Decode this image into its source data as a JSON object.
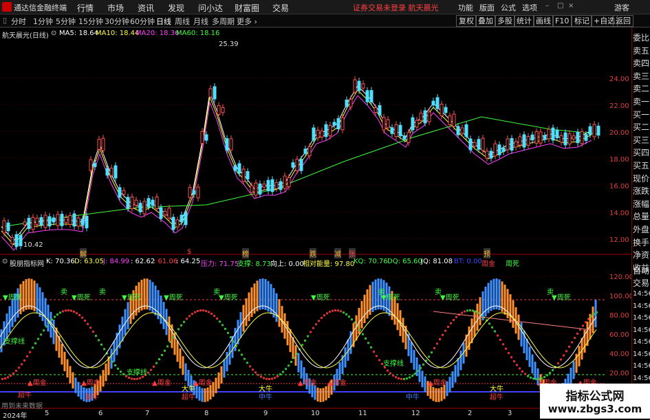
{
  "app": {
    "name": "通达信金融终端"
  },
  "menu": [
    "行情",
    "市场",
    "资讯",
    "发现",
    "问小达",
    "财富圈",
    "交易"
  ],
  "notice": "证券交易未登录  航天晨光",
  "right_menu": [
    "功能",
    "版面",
    "公式",
    "选项",
    "画线",
    "游客"
  ],
  "timeframes": [
    "分时",
    "1分钟",
    "5分钟",
    "15分钟",
    "30分钟",
    "60分钟",
    "日线",
    "周线",
    "月线",
    "多周期",
    "更多"
  ],
  "active_timeframe": "日线",
  "toolbar_buttons": [
    "复权",
    "叠加",
    "多股",
    "统计",
    "画线",
    "F10",
    "标记",
    "+自选",
    "返回"
  ],
  "price_chart": {
    "title": "航天晨光(日线)",
    "ma": [
      {
        "label": "MA5: 18.64",
        "color": "#ffffff"
      },
      {
        "label": "MA10: 18.44",
        "color": "#ffff40"
      },
      {
        "label": "MA20: 18.36",
        "color": "#ff40ff"
      },
      {
        "label": "MA60: 18.16",
        "color": "#40ff40"
      }
    ],
    "y_ticks": [
      "24.00",
      "22.00",
      "20.00",
      "18.00",
      "16.00",
      "14.00",
      "12.00"
    ],
    "high_label": "25.39",
    "low_label": "10.42",
    "event_markers": [
      "解",
      "$",
      "榜",
      "跌",
      "减",
      "张",
      "预"
    ]
  },
  "indicator": {
    "name": "股朋指标网",
    "values": [
      {
        "label": "K: 70.36",
        "color": "#ffffff"
      },
      {
        "label": "D: 63.05",
        "color": "#ffff40"
      },
      {
        "label": "J: 84.99",
        "color": "#ff40ff"
      },
      {
        "label": ": 62.62",
        "color": "#ffffff"
      },
      {
        "label": ": 61.06",
        "color": "#ff4040"
      },
      {
        "label": ": 64.25",
        "color": "#ffffff"
      },
      {
        "label": "压力: 71.75",
        "color": "#ff40ff"
      },
      {
        "label": "支撑: 8.73",
        "color": "#40ff40"
      },
      {
        "label": "向上: 0.00",
        "color": "#ffffff"
      },
      {
        "label": "相对能量: 97.80",
        "color": "#ffff40"
      },
      {
        "label": "KQ: 70.76",
        "color": "#40ff40"
      },
      {
        "label": "DQ: 65.60",
        "color": "#40ff40"
      },
      {
        "label": "JQ: 81.08",
        "color": "#ffffff"
      },
      {
        "label": "BT: 0.00",
        "color": "#4040ff"
      },
      {
        "label": "周金",
        "color": "#ff4040"
      },
      {
        "label": "周死",
        "color": "#40ff40"
      }
    ],
    "y_ticks": [
      "120.00",
      "100.00",
      "80.00",
      "60.00",
      "40.00",
      "20.00"
    ],
    "signals": {
      "zhousi": "周死",
      "mai": "卖",
      "zhoujin": "周金",
      "chaoniu": "超牛",
      "zhongniu": "中牛",
      "daniu": "大牛",
      "zhicheng": "支撑线"
    }
  },
  "x_axis": [
    "2024年",
    "5",
    "6",
    "7",
    "8",
    "9",
    "10",
    "11",
    "12",
    "2",
    "3",
    "4"
  ],
  "right_panel": [
    "委比",
    "卖五",
    "卖四",
    "卖三",
    "卖二",
    "卖一",
    "买一",
    "买二",
    "买三",
    "买四",
    "买五",
    "现价",
    "涨跌",
    "涨幅",
    "总量",
    "外盘",
    "换手",
    "净资",
    "收益"
  ],
  "right_panel_bottom": [
    "自动",
    "交易"
  ],
  "time_labels": [
    "14:56",
    "14:56",
    "14:56",
    "14:56",
    "14:56",
    "14:56",
    "14:56",
    "14:56"
  ],
  "footer_text": "用到未来数据",
  "watermark": {
    "line1": "指标公式网",
    "line2": "www.zbgs3.com"
  }
}
